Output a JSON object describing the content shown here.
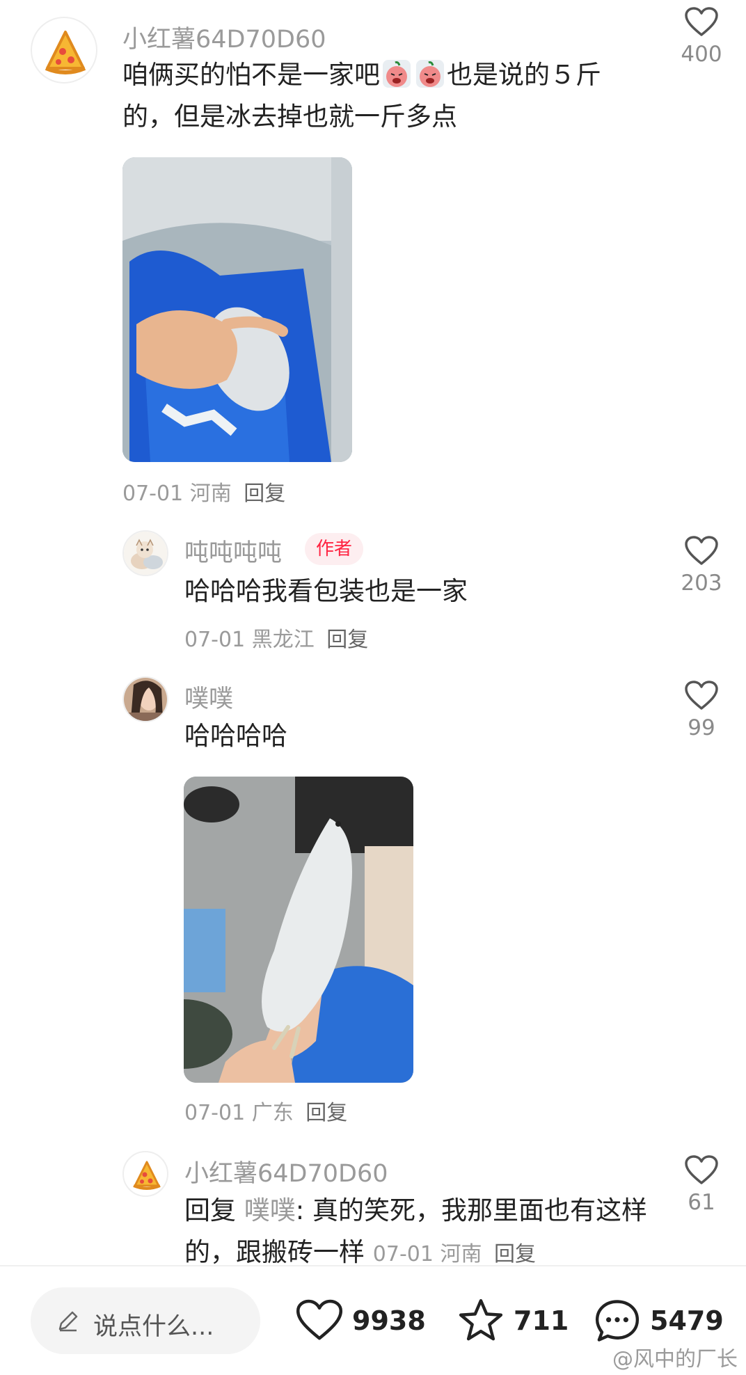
{
  "comments": [
    {
      "username": "小红薯64D70D60",
      "text": "咱俩买的怕不是一家吧",
      "text_tail": "也是说的５斤的，但是冰去掉也就一斤多点",
      "meta_date": "07-01",
      "meta_region": "河南",
      "reply_label": "回复",
      "likes": "400"
    },
    {
      "username": "吨吨吨吨",
      "badge": "作者",
      "text": "哈哈哈我看包装也是一家",
      "meta_date": "07-01",
      "meta_region": "黑龙江",
      "reply_label": "回复",
      "likes": "203"
    },
    {
      "username": "噗噗",
      "text": "哈哈哈哈",
      "meta_date": "07-01",
      "meta_region": "广东",
      "reply_label": "回复",
      "likes": "99"
    },
    {
      "username": "小红薯64D70D60",
      "reply_prefix": "回复",
      "reply_to": "噗噗",
      "text": ": 真的笑死，我那里面也有这样的，跟搬砖一样",
      "meta_date": "07-01",
      "meta_region": "河南",
      "reply_label": "回复",
      "likes": "61"
    }
  ],
  "bottom_bar": {
    "input_placeholder": "说点什么...",
    "likes": "9938",
    "favorites": "711",
    "comments": "5479",
    "watermark": "@风中的厂长"
  },
  "colors": {
    "accent": "#ff2442",
    "secondary_text": "#9a9a9a",
    "primary_text": "#222222"
  }
}
